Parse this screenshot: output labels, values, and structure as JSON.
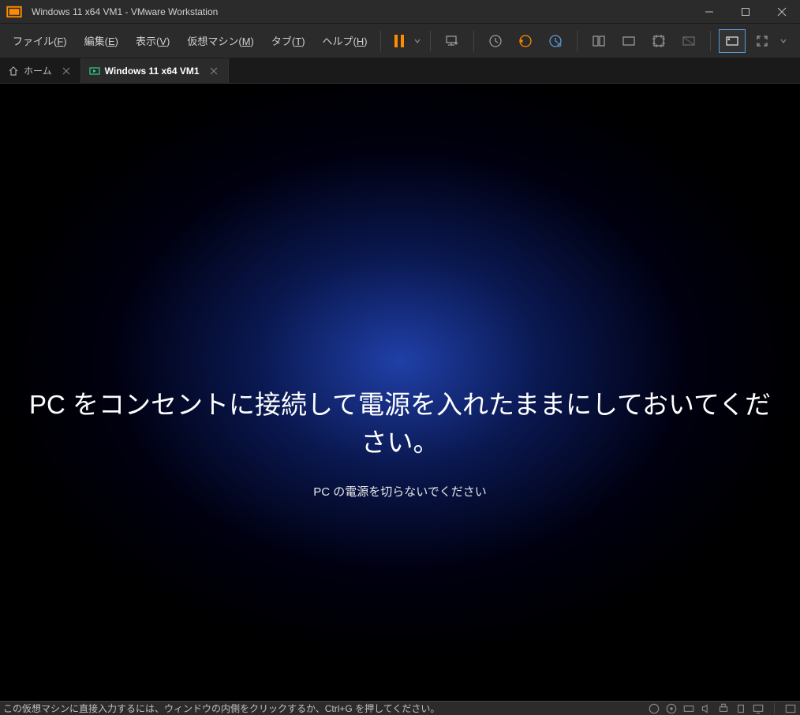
{
  "titlebar": {
    "title": "Windows 11 x64 VM1 - VMware Workstation"
  },
  "menu": {
    "file": "ファイル(",
    "file_u": "F",
    "file_end": ")",
    "edit": "編集(",
    "edit_u": "E",
    "edit_end": ")",
    "view": "表示(",
    "view_u": "V",
    "view_end": ")",
    "vm": "仮想マシン(",
    "vm_u": "M",
    "vm_end": ")",
    "tab": "タブ(",
    "tab_u": "T",
    "tab_end": ")",
    "help": "ヘルプ(",
    "help_u": "H",
    "help_end": ")"
  },
  "tabs": {
    "home": "ホーム",
    "vm1": "Windows 11 x64 VM1"
  },
  "guest": {
    "title": "PC をコンセントに接続して電源を入れたままにしておいてください。",
    "subtitle": "PC の電源を切らないでください"
  },
  "statusbar": {
    "text": "この仮想マシンに直接入力するには、ウィンドウの内側をクリックするか、Ctrl+G を押してください。"
  }
}
